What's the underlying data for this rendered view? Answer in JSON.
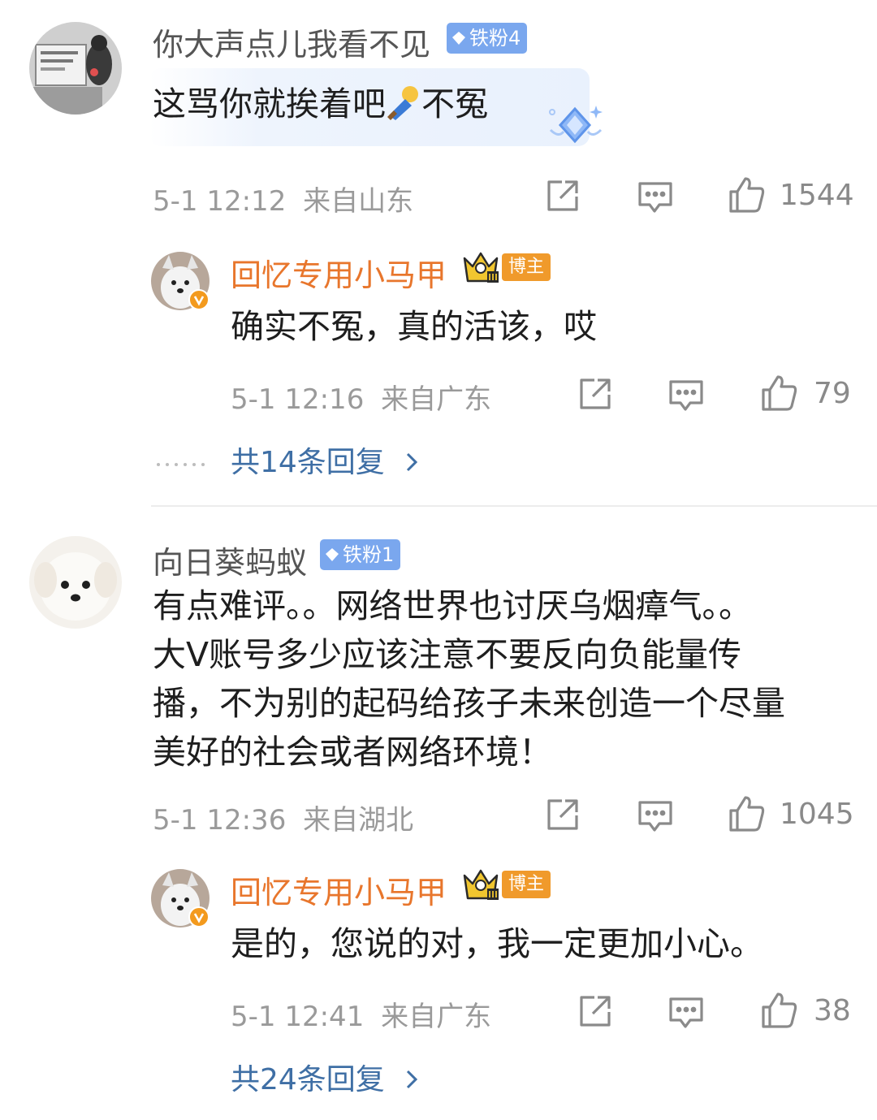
{
  "comments": [
    {
      "author": "你大声点儿我看不见",
      "fan_badge": "铁粉4",
      "text": "这骂你就挨着吧",
      "text_emoji": "clown-emoji",
      "text_tail": "不冤",
      "time": "5-1 12:12",
      "location": "来自山东",
      "likes": "1544",
      "reply": {
        "author": "回忆专用小马甲",
        "badge": "博主",
        "text": "确实不冤，真的活该，哎",
        "time": "5-1 12:16",
        "location": "来自广东",
        "likes": "79"
      },
      "more_replies": "共14条回复"
    },
    {
      "author": "向日葵蚂蚁",
      "fan_badge": "铁粉1",
      "text_lines": [
        "有点难评。。网络世界也讨厌乌烟瘴气。。",
        "大V账号多少应该注意不要反向负能量传",
        "播，不为别的起码给孩子未来创造一个尽量",
        "美好的社会或者网络环境！"
      ],
      "time": "5-1 12:36",
      "location": "来自湖北",
      "likes": "1045",
      "reply": {
        "author": "回忆专用小马甲",
        "badge": "博主",
        "text": "是的，您说的对，我一定更加小心。",
        "time": "5-1 12:41",
        "location": "来自广东",
        "likes": "38"
      },
      "more_replies": "共24条回复"
    }
  ],
  "icons": {
    "share": "share-icon",
    "comment": "comment-icon",
    "like": "like-icon",
    "chevron": "chevron-right-icon",
    "crown": "crown-icon",
    "verified": "verified-v-icon",
    "diamond": "diamond-icon",
    "ellipsis": "ellipsis-dots"
  },
  "colors": {
    "blogger_name": "#e8762c",
    "link": "#3f6fa5",
    "fan_badge": "#7aa7ee",
    "blogger_badge": "#f09a2b",
    "meta": "#9a9a9a"
  }
}
